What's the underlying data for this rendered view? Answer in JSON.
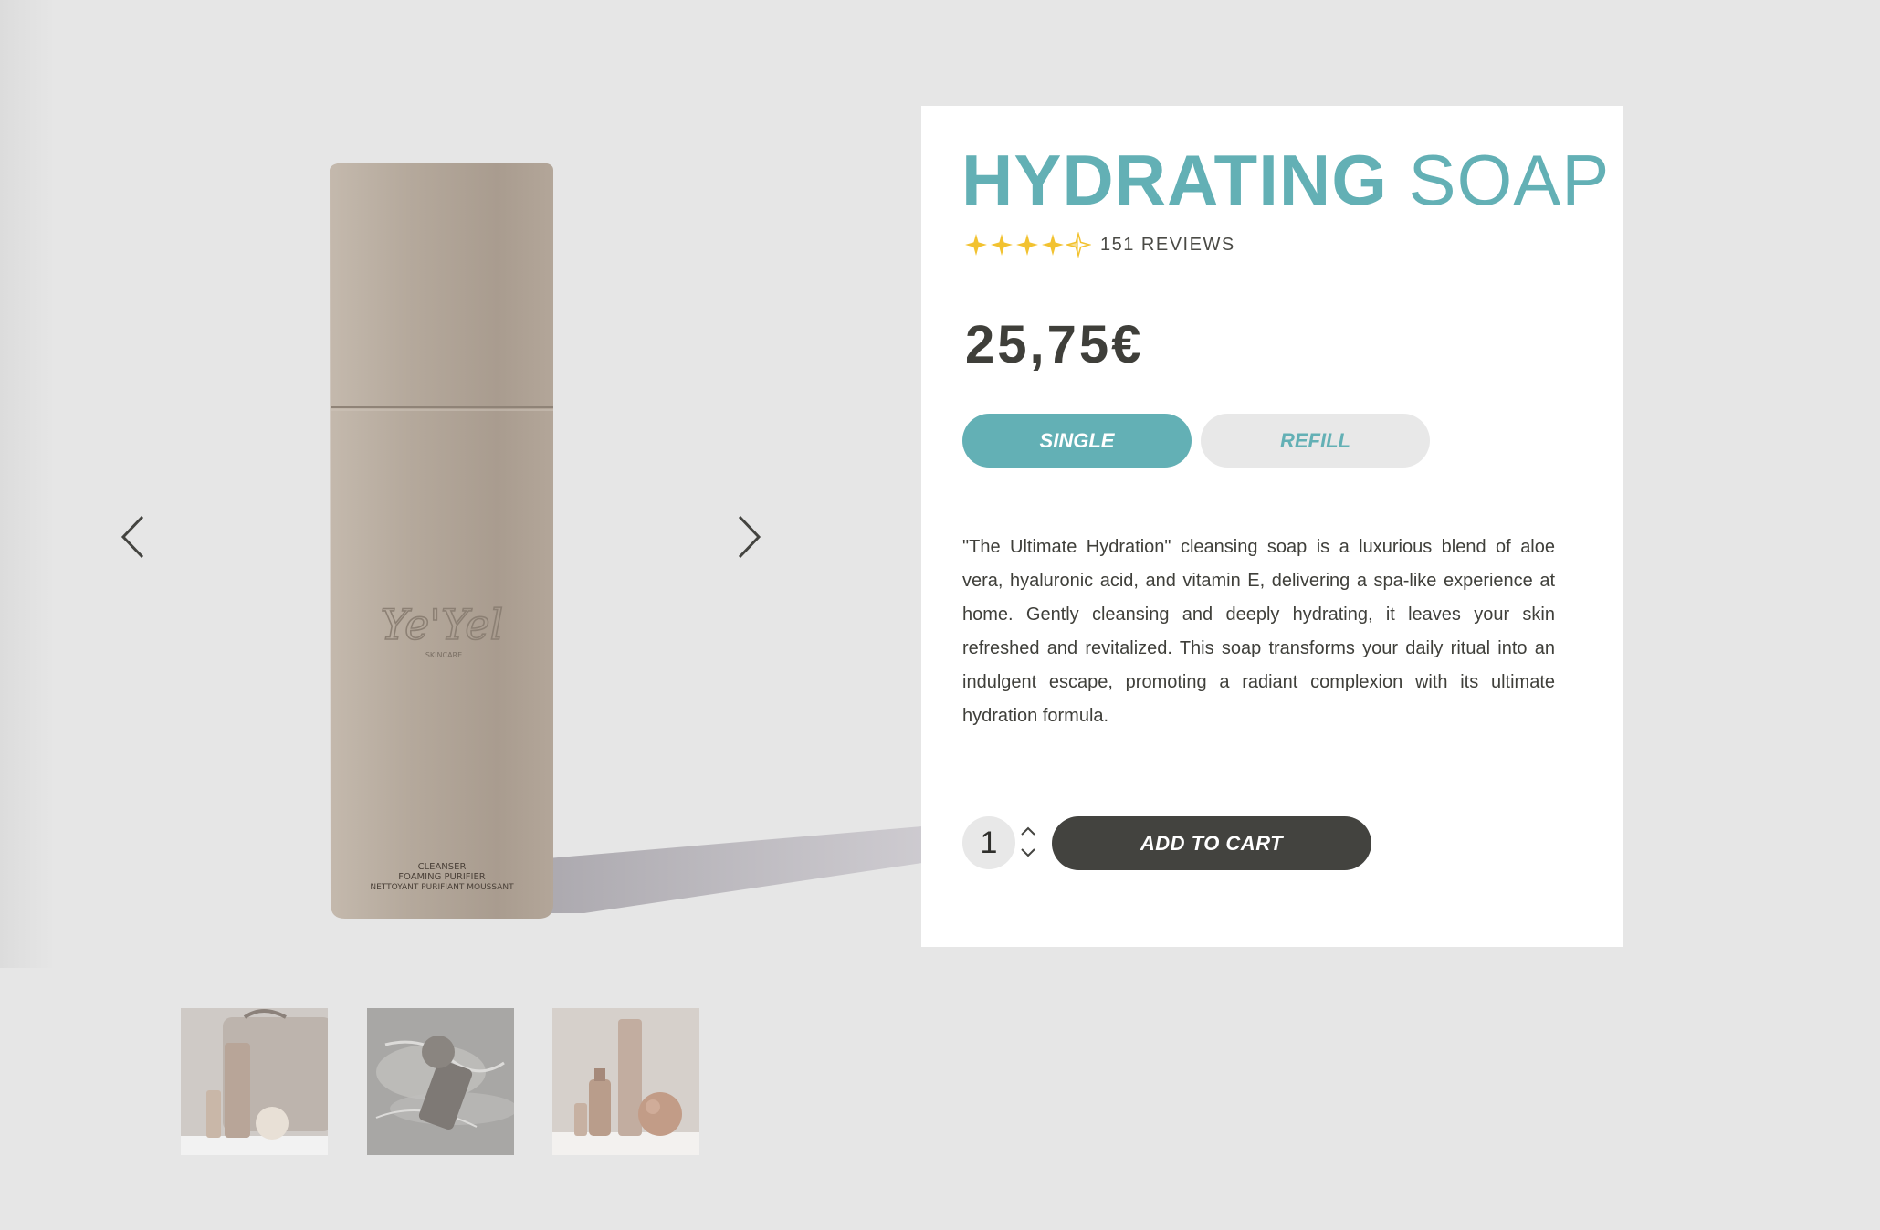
{
  "product": {
    "title_bold": "HYDRATING",
    "title_light": "SOAP",
    "rating": 4.5,
    "rating_max": 5,
    "reviews_label": "151 REVIEWS",
    "price": "25,75€",
    "variants": [
      {
        "label": "SINGLE",
        "selected": true
      },
      {
        "label": "REFILL",
        "selected": false
      }
    ],
    "description": "\"The Ultimate Hydration\" cleansing soap is a luxurious blend of aloe vera, hyaluronic acid, and vitamin E, delivering a spa-like experience at home. Gently cleansing and deeply hydrating, it leaves your skin refreshed and revitalized. This soap transforms your daily ritual into an indulgent escape, promoting a radiant complexion with its ultimate hydration formula.",
    "quantity": "1",
    "add_to_cart_label": "ADD TO CART"
  },
  "image": {
    "logo_text": "Ye'Yel",
    "logo_sub": "SKINCARE",
    "label_lines": [
      "CLEANSER",
      "FOAMING PURIFIER",
      "NETTOYANT PURIFIANT MOUSSANT"
    ]
  },
  "icons": {
    "prev": "chevron-left-icon",
    "next": "chevron-right-icon",
    "star": "star-icon",
    "up": "chevron-up-icon",
    "down": "chevron-down-icon"
  },
  "colors": {
    "accent": "#63b0b5",
    "star": "#f2c230",
    "button_dark": "#43433f",
    "background": "#e6e6e6",
    "card": "#ffffff"
  }
}
